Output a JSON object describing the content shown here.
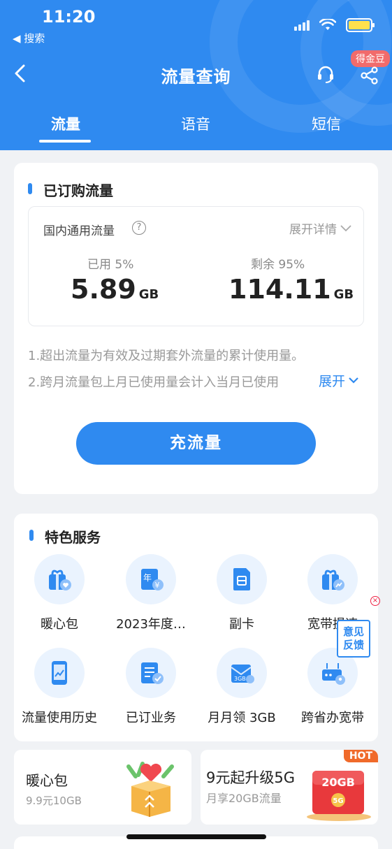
{
  "status_bar": {
    "time": "11:20",
    "back_app": "◀ 搜索"
  },
  "nav": {
    "title": "流量查询",
    "badge": "得金豆"
  },
  "tabs": [
    {
      "label": "流量"
    },
    {
      "label": "语音"
    },
    {
      "label": "短信"
    }
  ],
  "flow_card": {
    "title": "已订购流量",
    "type_label": "国内通用流量",
    "help_glyph": "?",
    "expand_detail": "展开详情",
    "used_label": "已用 5%",
    "used_value": "5.89",
    "used_unit": "GB",
    "remain_label": "剩余 95%",
    "remain_value": "114.11",
    "remain_unit": "GB",
    "notes": [
      "1.超出流量为有效及过期套外流量的累计使用量。",
      "2.跨月流量包上月已使用量会计入当月已使用"
    ],
    "notes_expand": "展开",
    "recharge_button": "充流量"
  },
  "service_card": {
    "title": "特色服务",
    "items": [
      {
        "label": "暖心包",
        "icon": "gift-heart-icon"
      },
      {
        "label": "2023年度…",
        "icon": "annual-report-icon"
      },
      {
        "label": "副卡",
        "icon": "sim-card-icon"
      },
      {
        "label": "宽带提速",
        "icon": "gift-speed-icon"
      },
      {
        "label": "流量使用历史",
        "icon": "phone-chart-icon"
      },
      {
        "label": "已订业务",
        "icon": "order-check-icon"
      },
      {
        "label": "月月领 3GB",
        "icon": "envelope-3gb-icon"
      },
      {
        "label": "跨省办宽带",
        "icon": "router-location-icon"
      }
    ]
  },
  "feedback": {
    "label_line1": "意见",
    "label_line2": "反馈",
    "close_glyph": "×"
  },
  "promos": [
    {
      "title": "暖心包",
      "subtitle": "9.9元10GB"
    },
    {
      "title": "9元起升级5G",
      "subtitle": "月享20GB流量",
      "badge": "HOT",
      "art_text": "20GB",
      "art_sub": "5G"
    }
  ],
  "colors": {
    "brand_blue": "#2f8af0",
    "hot_orange": "#f06a2a",
    "badge_red": "#f16b6b"
  }
}
